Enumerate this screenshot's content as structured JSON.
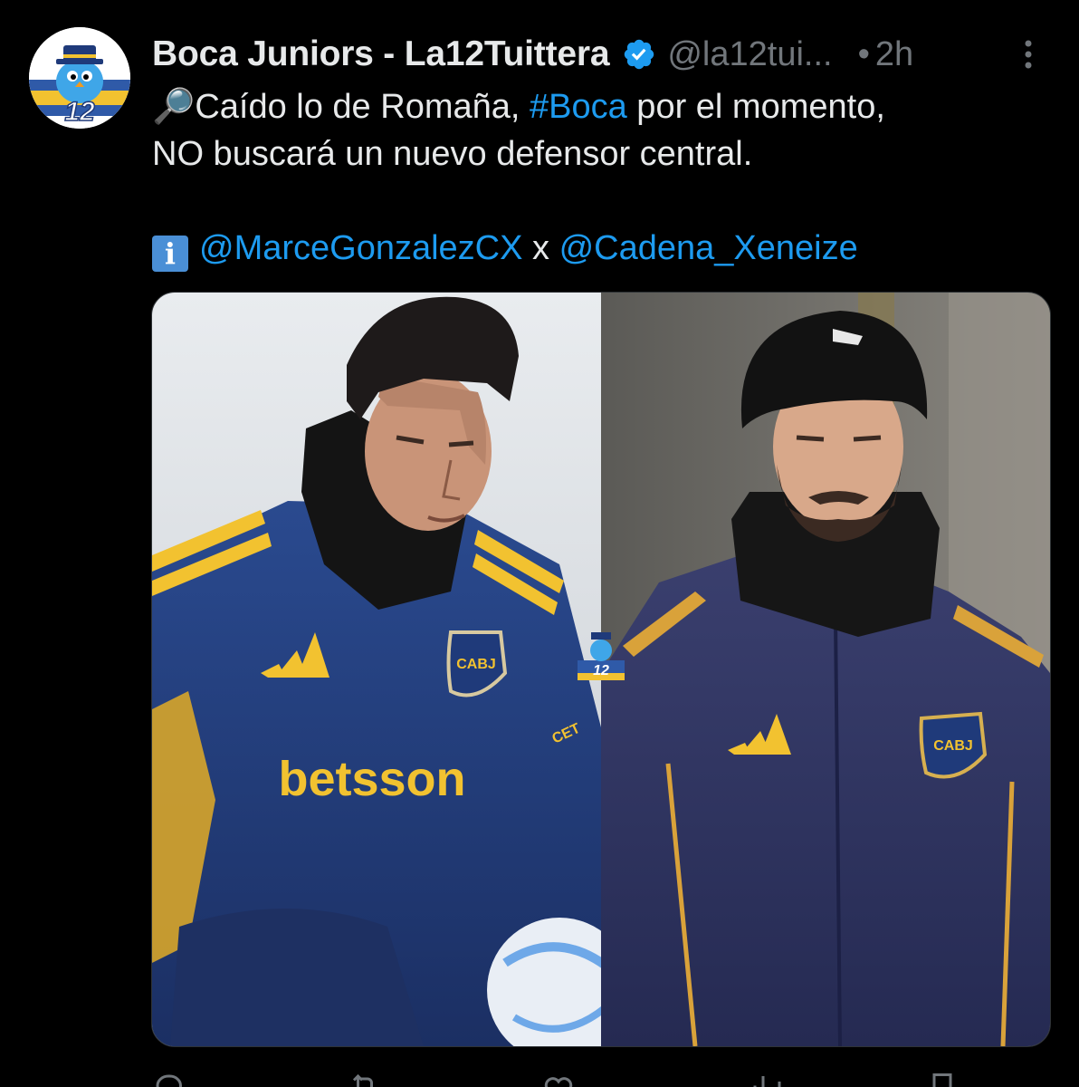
{
  "tweet": {
    "display_name": "Boca Juniors - La12Tuittera",
    "handle": "@la12tui...",
    "separator": "•",
    "time": "2h",
    "avatar_text": "12",
    "text": {
      "line1_prefix_emoji": "🔎",
      "line1_a": "Caído lo de Romaña, ",
      "line1_hashtag": "#Boca",
      "line1_b": " por el momento,",
      "line2": "NO buscará un nuevo defensor central.",
      "info_emoji": "i",
      "mention1": "@MarceGonzalezCX",
      "joiner": " x ",
      "mention2": "@Cadena_Xeneize"
    },
    "media": {
      "left_sponsor": "betsson",
      "left_badge": "CABJ",
      "right_badge": "CABJ",
      "center_logo_text": "12",
      "left_sleeve_text": "CET"
    }
  },
  "colors": {
    "background": "#000000",
    "primary_text": "#e7e9ea",
    "secondary_text": "#71767b",
    "link": "#1d9bf0",
    "boca_blue": "#1f3a7a",
    "boca_gold": "#f2c230"
  },
  "icons": {
    "verified": "verified-badge-icon",
    "more": "more-vertical-icon",
    "reply": "reply-icon",
    "retweet": "retweet-icon",
    "like": "heart-icon",
    "views": "views-icon",
    "bookmark": "bookmark-icon"
  }
}
